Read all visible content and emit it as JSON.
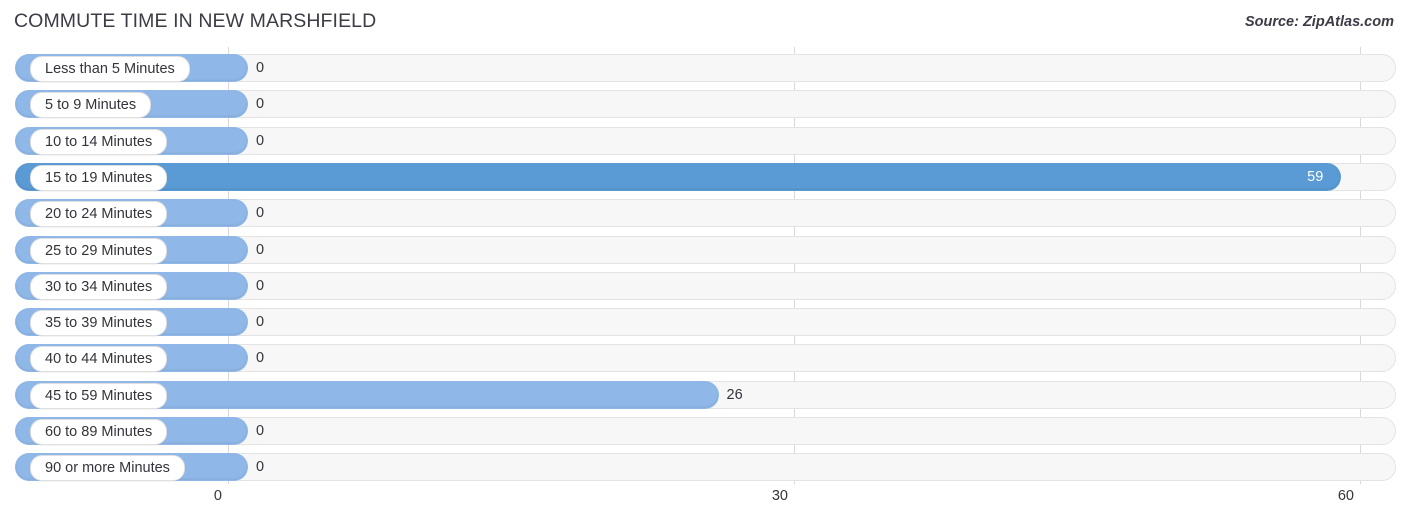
{
  "header": {
    "title": "COMMUTE TIME IN NEW MARSHFIELD",
    "source": "Source: ZipAtlas.com"
  },
  "colors": {
    "bar_light": "#8fb8e8",
    "bar_highlight": "#5b9bd5",
    "track": "#f7f7f7",
    "track_border": "#e3e3e3",
    "gridline": "#d9d9d9",
    "text": "#33333b"
  },
  "chart_data": {
    "type": "bar",
    "orientation": "horizontal",
    "title": "COMMUTE TIME IN NEW MARSHFIELD",
    "xlabel": "",
    "ylabel": "",
    "xlim": [
      0,
      60
    ],
    "grid": true,
    "legend": false,
    "tick_labels": [
      "0",
      "30",
      "60"
    ],
    "ticks": [
      0,
      30,
      60
    ],
    "categories": [
      "Less than 5 Minutes",
      "5 to 9 Minutes",
      "10 to 14 Minutes",
      "15 to 19 Minutes",
      "20 to 24 Minutes",
      "25 to 29 Minutes",
      "30 to 34 Minutes",
      "35 to 39 Minutes",
      "40 to 44 Minutes",
      "45 to 59 Minutes",
      "60 to 89 Minutes",
      "90 or more Minutes"
    ],
    "values": [
      0,
      0,
      0,
      59,
      0,
      0,
      0,
      0,
      0,
      26,
      0,
      0
    ],
    "value_labels": [
      "0",
      "0",
      "0",
      "59",
      "0",
      "0",
      "0",
      "0",
      "0",
      "26",
      "0",
      "0"
    ]
  },
  "rows": [
    {
      "label": "Less than 5 Minutes",
      "value": 0,
      "value_label": "0",
      "highlight": false
    },
    {
      "label": "5 to 9 Minutes",
      "value": 0,
      "value_label": "0",
      "highlight": false
    },
    {
      "label": "10 to 14 Minutes",
      "value": 0,
      "value_label": "0",
      "highlight": false
    },
    {
      "label": "15 to 19 Minutes",
      "value": 59,
      "value_label": "59",
      "highlight": true
    },
    {
      "label": "20 to 24 Minutes",
      "value": 0,
      "value_label": "0",
      "highlight": false
    },
    {
      "label": "25 to 29 Minutes",
      "value": 0,
      "value_label": "0",
      "highlight": false
    },
    {
      "label": "30 to 34 Minutes",
      "value": 0,
      "value_label": "0",
      "highlight": false
    },
    {
      "label": "35 to 39 Minutes",
      "value": 0,
      "value_label": "0",
      "highlight": false
    },
    {
      "label": "40 to 44 Minutes",
      "value": 0,
      "value_label": "0",
      "highlight": false
    },
    {
      "label": "45 to 59 Minutes",
      "value": 26,
      "value_label": "26",
      "highlight": false
    },
    {
      "label": "60 to 89 Minutes",
      "value": 0,
      "value_label": "0",
      "highlight": false
    },
    {
      "label": "90 or more Minutes",
      "value": 0,
      "value_label": "0",
      "highlight": false
    }
  ]
}
